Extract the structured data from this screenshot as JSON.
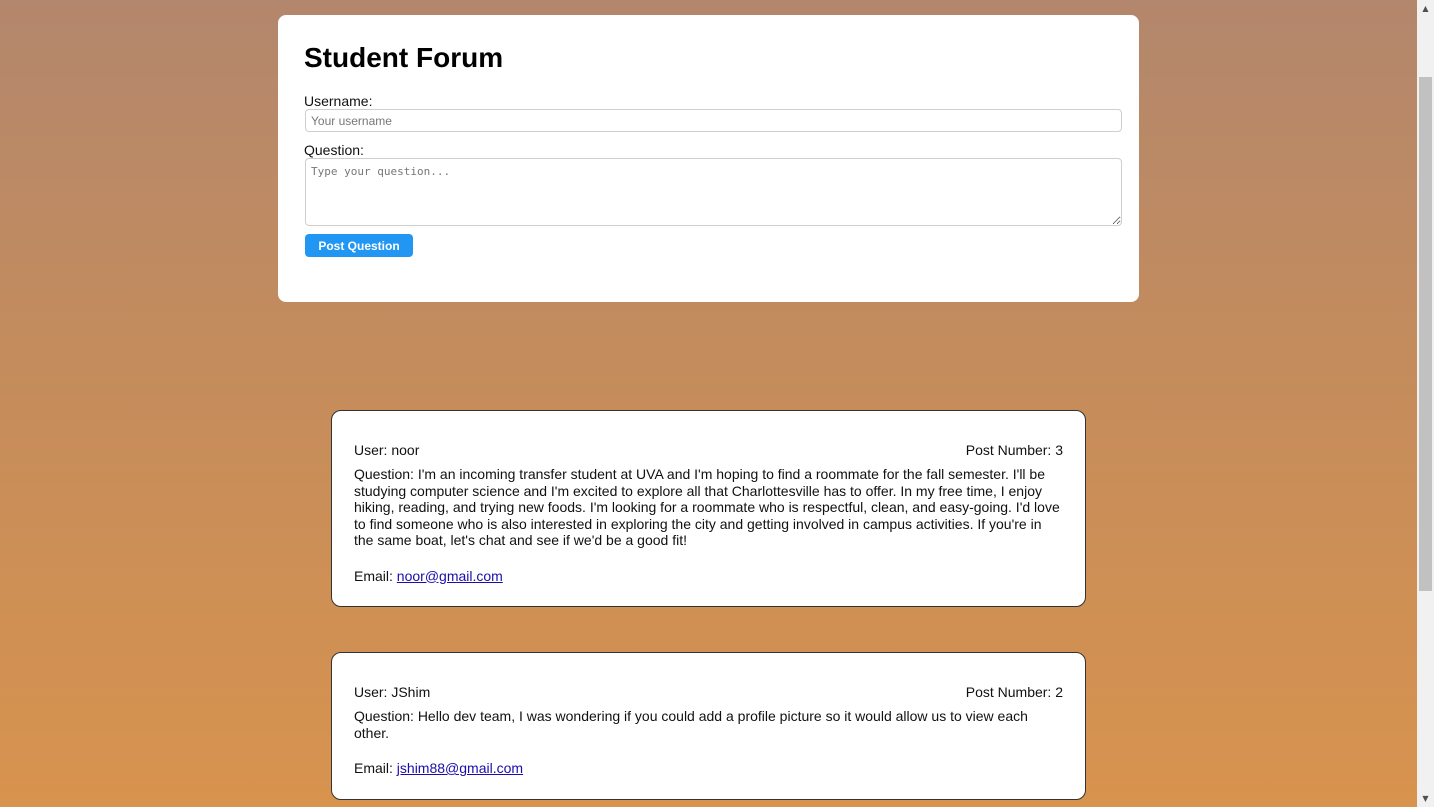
{
  "form": {
    "title": "Student Forum",
    "username_label": "Username:",
    "username_placeholder": "Your username",
    "username_value": "",
    "question_label": "Question:",
    "question_placeholder": "Type your question...",
    "question_value": "",
    "submit_label": "Post Question"
  },
  "posts": [
    {
      "user": "User: noor",
      "post_number": "Post Number: 3",
      "question": "Question: I'm an incoming transfer student at UVA and I'm hoping to find a roommate for the fall semester. I'll be studying computer science and I'm excited to explore all that Charlottesville has to offer. In my free time, I enjoy hiking, reading, and trying new foods. I'm looking for a roommate who is respectful, clean, and easy-going. I'd love to find someone who is also interested in exploring the city and getting involved in campus activities. If you're in the same boat, let's chat and see if we'd be a good fit!",
      "email_label": "Email: ",
      "email": "noor@gmail.com"
    },
    {
      "user": "User: JShim",
      "post_number": "Post Number: 2",
      "question": "Question: Hello dev team, I was wondering if you could add a profile picture so it would allow us to view each other.",
      "email_label": "Email: ",
      "email": "jshim88@gmail.com"
    }
  ],
  "scrollbar": {
    "up_icon": "triangle-up-icon",
    "down_icon": "triangle-down-icon"
  },
  "colors": {
    "background_top": "#b3876d",
    "background_bottom": "#d8934e",
    "button": "#2196f3",
    "link": "#1a0dab"
  }
}
